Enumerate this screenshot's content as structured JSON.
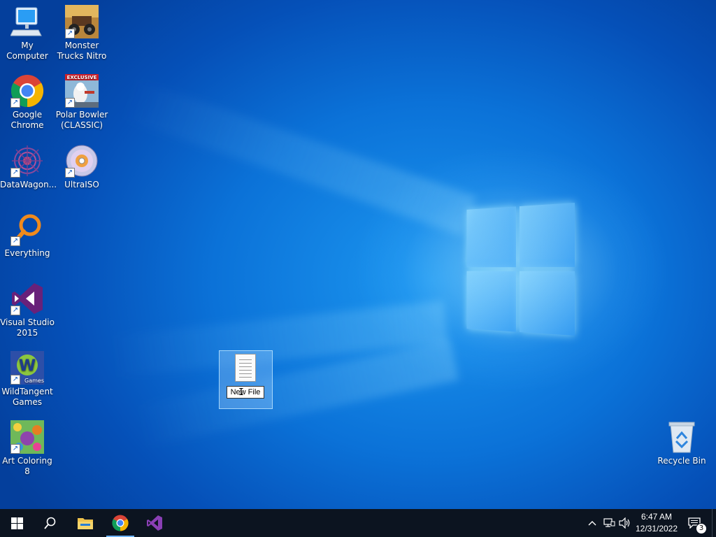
{
  "desktop": {
    "icons": [
      {
        "id": "my-computer",
        "label": "My Computer",
        "icon": "computer-icon"
      },
      {
        "id": "monster-trucks",
        "label": "Monster Trucks Nitro",
        "icon": "monster-trucks-icon"
      },
      {
        "id": "google-chrome",
        "label": "Google Chrome",
        "icon": "chrome-icon"
      },
      {
        "id": "polar-bowler",
        "label": "Polar Bowler (CLASSIC)",
        "icon": "polar-bowler-icon",
        "badge": "EXCLUSIVE"
      },
      {
        "id": "datawagon",
        "label": "DataWagon...",
        "icon": "datawagon-icon"
      },
      {
        "id": "ultraiso",
        "label": "UltraISO",
        "icon": "ultraiso-icon"
      },
      {
        "id": "everything",
        "label": "Everything",
        "icon": "everything-icon"
      },
      {
        "id": "visual-studio",
        "label": "Visual Studio 2015",
        "icon": "visual-studio-icon"
      },
      {
        "id": "wildtangent",
        "label": "WildTangent Games",
        "icon": "wildtangent-icon",
        "sublabel": "Games"
      },
      {
        "id": "art-coloring",
        "label": "Art Coloring 8",
        "icon": "art-coloring-icon"
      },
      {
        "id": "recycle-bin",
        "label": "Recycle Bin",
        "icon": "recycle-bin-icon"
      }
    ],
    "selected_file": {
      "rename_value": "New File",
      "icon": "text-document-icon"
    }
  },
  "taskbar": {
    "buttons": [
      {
        "name": "start",
        "icon": "windows-logo-icon"
      },
      {
        "name": "search",
        "icon": "search-icon"
      },
      {
        "name": "file-explorer",
        "icon": "folder-icon"
      },
      {
        "name": "chrome",
        "icon": "chrome-icon"
      },
      {
        "name": "visual-studio",
        "icon": "visual-studio-icon"
      }
    ],
    "tray": {
      "time": "6:47 AM",
      "date": "12/31/2022",
      "notification_count": "3"
    }
  },
  "colors": {
    "desktop_accent": "#0b72d8",
    "taskbar_bg": "#0c1420",
    "vs_purple": "#68217a"
  }
}
